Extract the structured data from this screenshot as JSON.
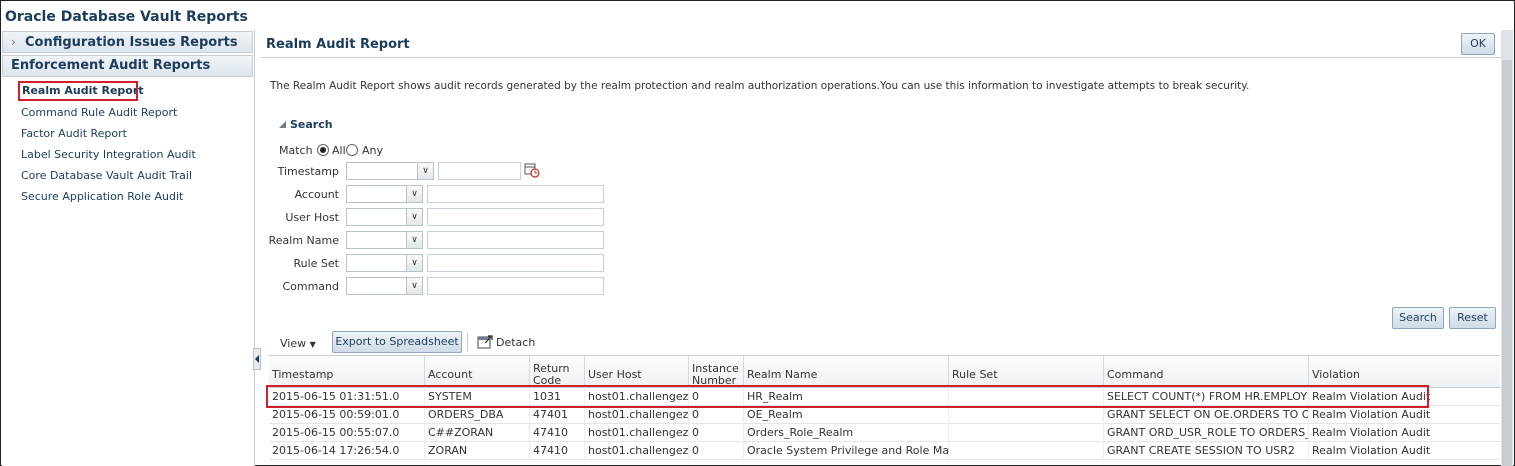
{
  "app_title": "Oracle Database Vault Reports",
  "left_panel": {
    "config_header": "Configuration Issues Reports",
    "enforcement_header": "Enforcement Audit Reports",
    "items": [
      {
        "label": "Realm Audit Report",
        "selected": true
      },
      {
        "label": "Command Rule Audit Report"
      },
      {
        "label": "Factor Audit Report"
      },
      {
        "label": "Label Security Integration Audit"
      },
      {
        "label": "Core Database Vault Audit Trail"
      },
      {
        "label": "Secure Application Role Audit"
      }
    ]
  },
  "main": {
    "title": "Realm Audit Report",
    "ok_label": "OK",
    "description": "The Realm Audit Report shows audit records generated by the realm protection and realm authorization operations.You can use this information to investigate attempts to break security."
  },
  "search": {
    "header": "Search",
    "match_label": "Match",
    "match_all": "All",
    "match_any": "Any",
    "fields": {
      "timestamp": "Timestamp",
      "account": "Account",
      "user_host": "User Host",
      "realm_name": "Realm Name",
      "rule_set": "Rule Set",
      "command": "Command"
    },
    "search_btn": "Search",
    "reset_btn": "Reset"
  },
  "toolbar": {
    "view": "View",
    "export": "Export to Spreadsheet",
    "detach": "Detach"
  },
  "table": {
    "columns": {
      "timestamp": "Timestamp",
      "account": "Account",
      "return_code_1": "Return",
      "return_code_2": "Code",
      "user_host": "User Host",
      "instance_1": "Instance",
      "instance_2": "Number",
      "realm_name": "Realm Name",
      "rule_set": "Rule Set",
      "command": "Command",
      "violation": "Violation"
    },
    "rows": [
      {
        "timestamp": "2015-06-15 01:31:51.0",
        "account": "SYSTEM",
        "return_code": "1031",
        "user_host": "host01.challengez...",
        "instance": "0",
        "realm_name": "HR_Realm",
        "rule_set": "",
        "command": "SELECT COUNT(*) FROM HR.EMPLOYEES",
        "violation": "Realm Violation Audit"
      },
      {
        "timestamp": "2015-06-15 00:59:01.0",
        "account": "ORDERS_DBA",
        "return_code": "47401",
        "user_host": "host01.challengez...",
        "instance": "0",
        "realm_name": "OE_Realm",
        "rule_set": "",
        "command": "GRANT SELECT ON OE.ORDERS TO OR...",
        "violation": "Realm Violation Audit"
      },
      {
        "timestamp": "2015-06-15 00:55:07.0",
        "account": "C##ZORAN",
        "return_code": "47410",
        "user_host": "host01.challengez...",
        "instance": "0",
        "realm_name": "Orders_Role_Realm",
        "rule_set": "",
        "command": "GRANT ORD_USR_ROLE TO ORDERS_U...",
        "violation": "Realm Violation Audit"
      },
      {
        "timestamp": "2015-06-14 17:26:54.0",
        "account": "ZORAN",
        "return_code": "47410",
        "user_host": "host01.challengez...",
        "instance": "0",
        "realm_name": "Oracle System Privilege and Role Mana...",
        "rule_set": "",
        "command": "GRANT CREATE SESSION TO USR2",
        "violation": "Realm Violation Audit"
      }
    ]
  },
  "colors": {
    "highlight_box": "#d0202a",
    "title_text": "#1c3c5c"
  }
}
